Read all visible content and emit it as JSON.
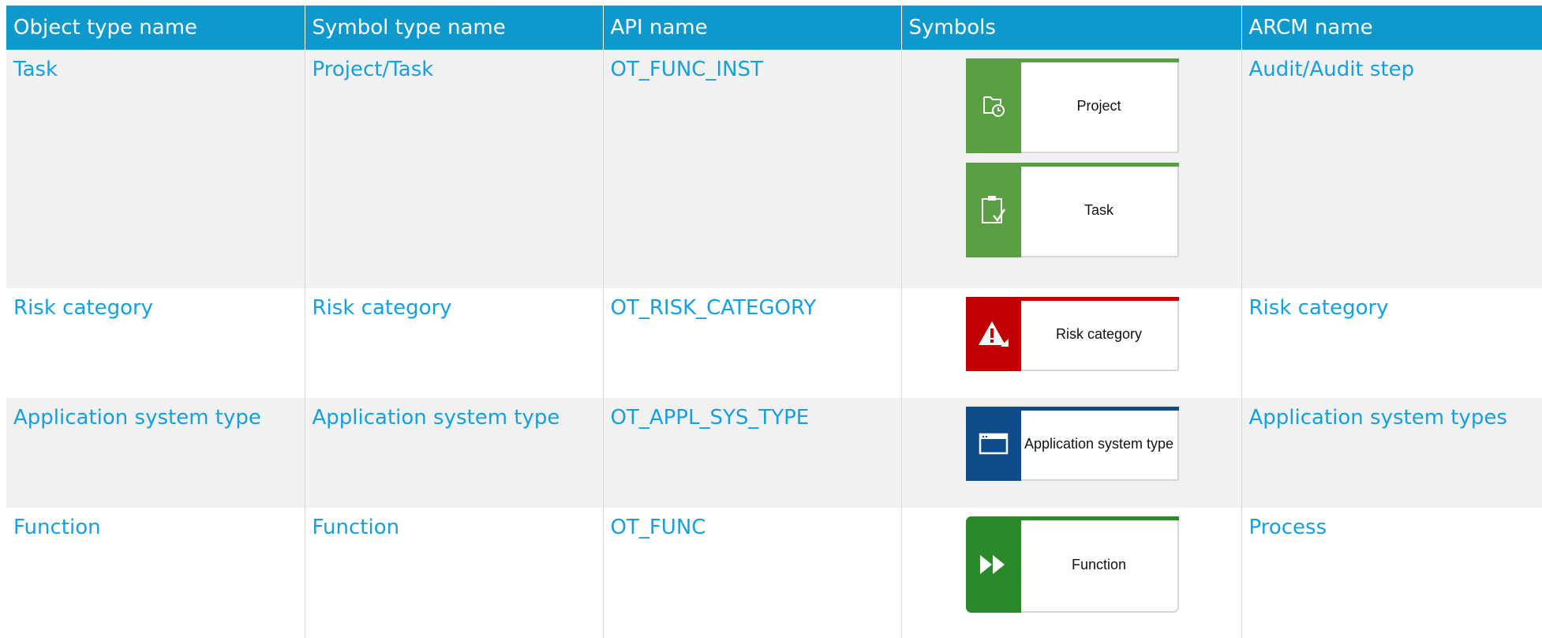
{
  "headers": [
    "Object type name",
    "Symbol type name",
    "API name",
    "Symbols",
    "ARCM name"
  ],
  "rows": [
    {
      "object_type": "Task",
      "symbol_type": "Project/Task",
      "api": "OT_FUNC_INST",
      "symbols": [
        {
          "label": "Project",
          "icon": "project-clock-icon",
          "color": "#5b9f45"
        },
        {
          "label": "Task",
          "icon": "clipboard-check-icon",
          "color": "#5b9f45"
        }
      ],
      "arcm": "Audit/Audit step"
    },
    {
      "object_type": "Risk category",
      "symbol_type": "Risk category",
      "api": "OT_RISK_CATEGORY",
      "symbols": [
        {
          "label": "Risk category",
          "icon": "warning-icon",
          "color": "#c00000"
        }
      ],
      "arcm": "Risk category"
    },
    {
      "object_type": "Application system type",
      "symbol_type": "Application system type",
      "api": "OT_APPL_SYS_TYPE",
      "symbols": [
        {
          "label": "Application system type",
          "icon": "window-icon",
          "color": "#0d4e8a"
        }
      ],
      "arcm": "Application system types"
    },
    {
      "object_type": "Function",
      "symbol_type": "Function",
      "api": "OT_FUNC",
      "symbols": [
        {
          "label": "Function",
          "icon": "fast-forward-icon",
          "color": "#2a8a29"
        }
      ],
      "arcm": "Process"
    }
  ]
}
